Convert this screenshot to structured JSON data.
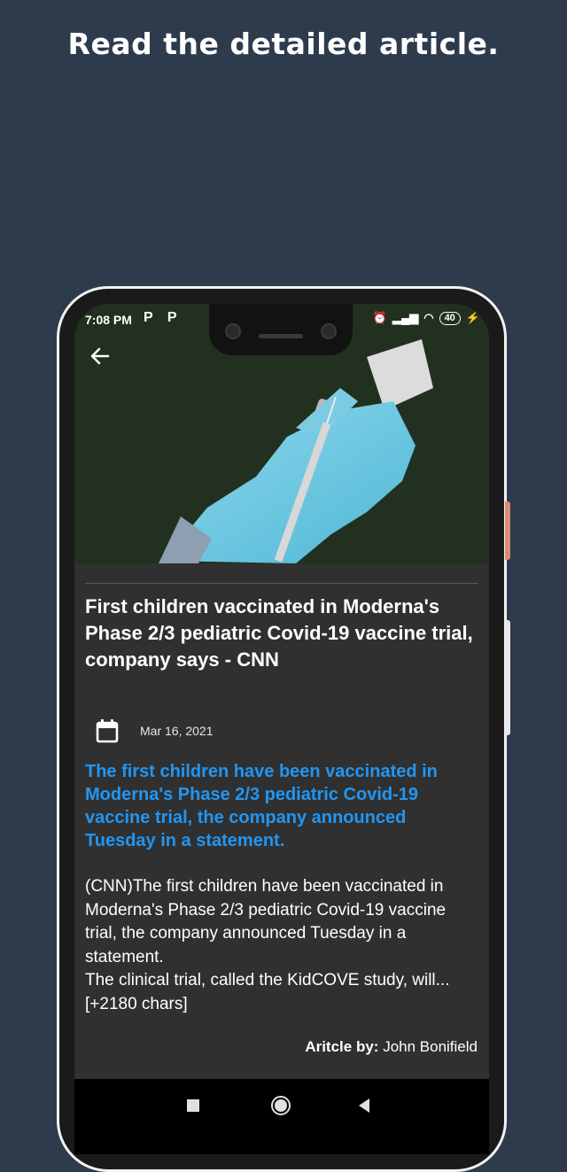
{
  "promo": {
    "title": "Read the detailed article."
  },
  "status_bar": {
    "time": "7:08 PM",
    "left_icons": "P P",
    "battery": "40"
  },
  "article": {
    "title": "First children vaccinated in Moderna's Phase 2/3 pediatric Covid-19 vaccine trial, company says - CNN",
    "date": "Mar 16, 2021",
    "description": "The first children have been vaccinated in Moderna's Phase 2/3 pediatric Covid-19 vaccine trial, the company announced Tuesday in a statement.",
    "content": "(CNN)The first children have been vaccinated in Moderna's Phase 2/3 pediatric Covid-19 vaccine trial, the company announced Tuesday in a statement.\nThe clinical trial, called the KidCOVE study, will... [+2180 chars]",
    "byline_label": "Aritcle by:",
    "author": "John Bonifield"
  },
  "colors": {
    "background": "#2d3b4d",
    "screen": "#303030",
    "accent": "#2196f3"
  },
  "icons": {
    "back": "arrow-left",
    "calendar": "calendar",
    "nav_recents": "square",
    "nav_home": "circle",
    "nav_back": "triangle-left"
  }
}
